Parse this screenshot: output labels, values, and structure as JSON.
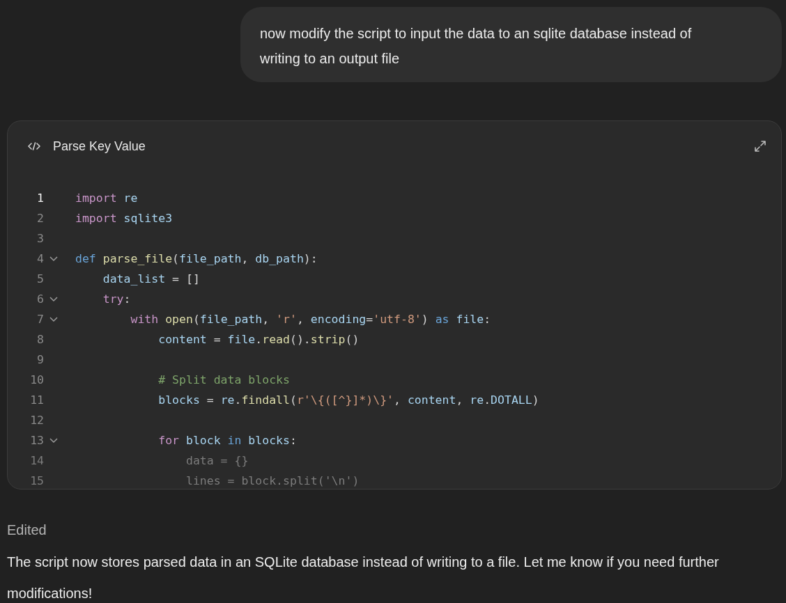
{
  "user_message": {
    "text": "now modify the script to input the data to an sqlite database instead of writing to an output file"
  },
  "code_card": {
    "title": "Parse Key Value",
    "lines": [
      {
        "number": "1",
        "selected": true,
        "foldable": false,
        "faded": false,
        "tokens": [
          {
            "text": "import",
            "kind": "kw"
          },
          {
            "text": " re",
            "kind": "var"
          }
        ]
      },
      {
        "number": "2",
        "selected": false,
        "foldable": false,
        "faded": false,
        "tokens": [
          {
            "text": "import",
            "kind": "kw"
          },
          {
            "text": " sqlite3",
            "kind": "var"
          }
        ]
      },
      {
        "number": "3",
        "selected": false,
        "foldable": false,
        "faded": false
      },
      {
        "number": "4",
        "selected": false,
        "foldable": true,
        "faded": false,
        "tokens": [
          {
            "text": "def",
            "kind": "kw2"
          },
          {
            "text": " parse_file",
            "kind": "fn"
          },
          {
            "text": "(",
            "kind": "plain"
          },
          {
            "text": "file_path",
            "kind": "var"
          },
          {
            "text": ", ",
            "kind": "plain"
          },
          {
            "text": "db_path",
            "kind": "var"
          },
          {
            "text": "):",
            "kind": "plain"
          }
        ]
      },
      {
        "number": "5",
        "selected": false,
        "foldable": false,
        "faded": false,
        "tokens": [
          {
            "text": "    data_list",
            "kind": "var"
          },
          {
            "text": " = []",
            "kind": "plain"
          }
        ]
      },
      {
        "number": "6",
        "selected": false,
        "foldable": true,
        "faded": false,
        "tokens": [
          {
            "text": "    try",
            "kind": "kw"
          },
          {
            "text": ":",
            "kind": "plain"
          }
        ]
      },
      {
        "number": "7",
        "selected": false,
        "foldable": true,
        "faded": false,
        "tokens": [
          {
            "text": "        with",
            "kind": "kw"
          },
          {
            "text": " open",
            "kind": "fn"
          },
          {
            "text": "(",
            "kind": "plain"
          },
          {
            "text": "file_path",
            "kind": "var"
          },
          {
            "text": ", ",
            "kind": "plain"
          },
          {
            "text": "'r'",
            "kind": "str"
          },
          {
            "text": ", ",
            "kind": "plain"
          },
          {
            "text": "encoding",
            "kind": "var"
          },
          {
            "text": "=",
            "kind": "plain"
          },
          {
            "text": "'utf-8'",
            "kind": "str"
          },
          {
            "text": ") ",
            "kind": "plain"
          },
          {
            "text": "as",
            "kind": "kw2"
          },
          {
            "text": " file",
            "kind": "var"
          },
          {
            "text": ":",
            "kind": "plain"
          }
        ]
      },
      {
        "number": "8",
        "selected": false,
        "foldable": false,
        "faded": false,
        "tokens": [
          {
            "text": "            content",
            "kind": "var"
          },
          {
            "text": " = ",
            "kind": "plain"
          },
          {
            "text": "file",
            "kind": "var"
          },
          {
            "text": ".",
            "kind": "plain"
          },
          {
            "text": "read",
            "kind": "fn"
          },
          {
            "text": "().",
            "kind": "plain"
          },
          {
            "text": "strip",
            "kind": "fn"
          },
          {
            "text": "()",
            "kind": "plain"
          }
        ]
      },
      {
        "number": "9",
        "selected": false,
        "foldable": false,
        "faded": false
      },
      {
        "number": "10",
        "selected": false,
        "foldable": false,
        "faded": false,
        "tokens": [
          {
            "text": "            # Split data blocks",
            "kind": "comment"
          }
        ]
      },
      {
        "number": "11",
        "selected": false,
        "foldable": false,
        "faded": false,
        "tokens": [
          {
            "text": "            blocks",
            "kind": "var"
          },
          {
            "text": " = ",
            "kind": "plain"
          },
          {
            "text": "re",
            "kind": "var"
          },
          {
            "text": ".",
            "kind": "plain"
          },
          {
            "text": "findall",
            "kind": "fn"
          },
          {
            "text": "(",
            "kind": "plain"
          },
          {
            "text": "r'\\{([^}]*)\\}'",
            "kind": "str"
          },
          {
            "text": ", ",
            "kind": "plain"
          },
          {
            "text": "content",
            "kind": "var"
          },
          {
            "text": ", ",
            "kind": "plain"
          },
          {
            "text": "re",
            "kind": "var"
          },
          {
            "text": ".",
            "kind": "plain"
          },
          {
            "text": "DOTALL",
            "kind": "var"
          },
          {
            "text": ")",
            "kind": "plain"
          }
        ]
      },
      {
        "number": "12",
        "selected": false,
        "foldable": false,
        "faded": false
      },
      {
        "number": "13",
        "selected": false,
        "foldable": true,
        "faded": false,
        "tokens": [
          {
            "text": "            for",
            "kind": "kw"
          },
          {
            "text": " block ",
            "kind": "var"
          },
          {
            "text": "in",
            "kind": "kw2"
          },
          {
            "text": " blocks",
            "kind": "var"
          },
          {
            "text": ":",
            "kind": "plain"
          }
        ]
      },
      {
        "number": "14",
        "selected": false,
        "foldable": false,
        "faded": true,
        "tokens": [
          {
            "text": "                data",
            "kind": "var"
          },
          {
            "text": " = {}",
            "kind": "plain"
          }
        ]
      },
      {
        "number": "15",
        "selected": false,
        "foldable": false,
        "faded": true,
        "tokens": [
          {
            "text": "                lines",
            "kind": "var"
          },
          {
            "text": " = ",
            "kind": "plain"
          },
          {
            "text": "block",
            "kind": "var"
          },
          {
            "text": ".",
            "kind": "plain"
          },
          {
            "text": "split",
            "kind": "fn"
          },
          {
            "text": "(",
            "kind": "plain"
          },
          {
            "text": "'\\n'",
            "kind": "str"
          },
          {
            "text": ")",
            "kind": "plain"
          }
        ]
      }
    ]
  },
  "status": {
    "text": "Edited"
  },
  "reply": {
    "text": "The script now stores parsed data in an SQLite database instead of writing to a file. Let me know if you need further modifications!"
  }
}
